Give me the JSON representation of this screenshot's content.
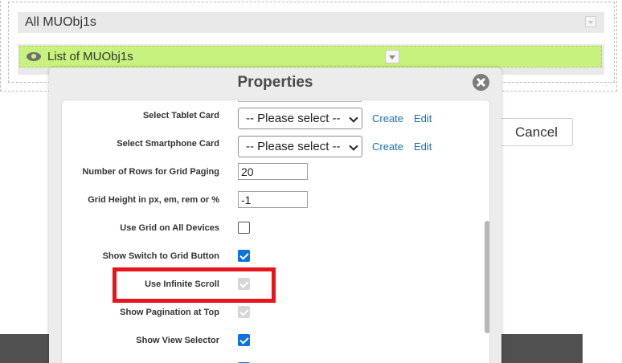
{
  "background": {
    "section_title": "All MUObj1s",
    "list_title": "List of MUObj1s",
    "cancel_label": "Cancel"
  },
  "dialog": {
    "title": "Properties",
    "rows": {
      "tablet_card": {
        "label": "Select Tablet Card",
        "value": "-- Please select --",
        "create": "Create",
        "edit": "Edit"
      },
      "smartphone_card": {
        "label": "Select Smartphone Card",
        "value": "-- Please select --",
        "create": "Create",
        "edit": "Edit"
      },
      "rows_per_page": {
        "label": "Number of Rows for Grid Paging",
        "value": "20"
      },
      "grid_height": {
        "label": "Grid Height in px, em, rem or %",
        "value": "-1"
      },
      "grid_all_devices": {
        "label": "Use Grid on All Devices",
        "checked": false,
        "disabled": false
      },
      "switch_to_grid": {
        "label": "Show Switch to Grid Button",
        "checked": true,
        "disabled": false
      },
      "infinite_scroll": {
        "label": "Use Infinite Scroll",
        "checked": true,
        "disabled": true
      },
      "pagination_top": {
        "label": "Show Pagination at Top",
        "checked": true,
        "disabled": true
      },
      "view_selector": {
        "label": "Show View Selector",
        "checked": true,
        "disabled": false
      }
    }
  },
  "colors": {
    "accent": "#0b73d9",
    "list_bar": "#c8f27e",
    "highlight": "#e8141c",
    "link": "#1a6fb4"
  }
}
